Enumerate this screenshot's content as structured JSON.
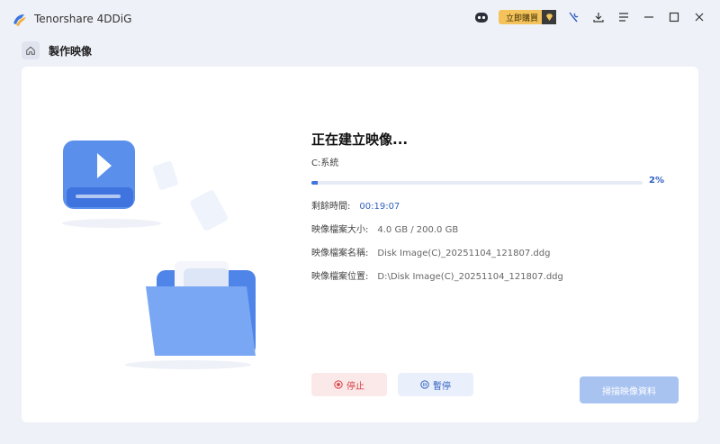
{
  "app": {
    "title": "Tenorshare 4DDiG",
    "buy_label": "立即購買"
  },
  "breadcrumb": {
    "title": "製作映像"
  },
  "main": {
    "heading": "正在建立映像...",
    "drive": "C:系統",
    "progress": {
      "percent": 2,
      "label": "2%"
    },
    "remaining": {
      "label": "剩餘時間:",
      "value": "00:19:07"
    },
    "size": {
      "label": "映像檔案大小:",
      "value": "4.0 GB / 200.0 GB"
    },
    "name": {
      "label": "映像檔案名稱:",
      "value": "Disk Image(C)_20251104_121807.ddg"
    },
    "location": {
      "label": "映像檔案位置:",
      "value": "D:\\Disk Image(C)_20251104_121807.ddg"
    },
    "stop_label": "停止",
    "pause_label": "暫停",
    "scan_label": "掃描映像資料"
  },
  "colors": {
    "accent": "#3e74de",
    "stop": "#d43d3d",
    "buy": "#f3c25a"
  },
  "icons": [
    "app-logo-icon",
    "robot-icon",
    "diamond-icon",
    "wrench-icon",
    "download-icon",
    "menu-icon",
    "minimize-icon",
    "maximize-icon",
    "close-icon",
    "home-icon",
    "stop-icon",
    "pause-icon"
  ]
}
